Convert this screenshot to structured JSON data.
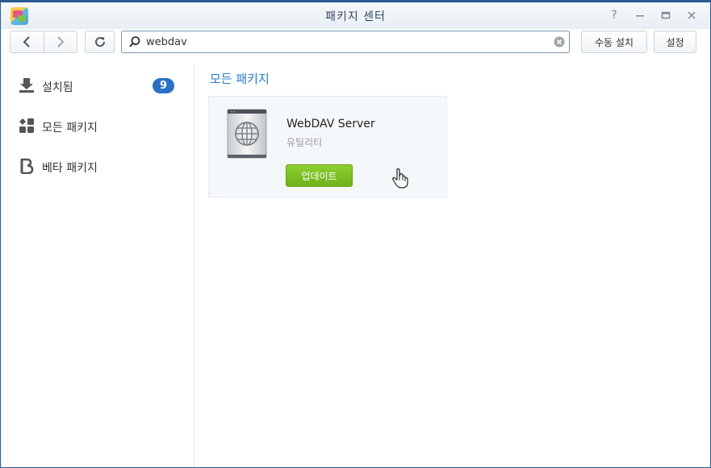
{
  "window": {
    "title": "패키지 센터"
  },
  "toolbar": {
    "search_value": "webdav",
    "manual_install_label": "수동 설치",
    "settings_label": "설정"
  },
  "sidebar": {
    "items": [
      {
        "label": "설치됨",
        "icon": "download-icon",
        "badge": "9"
      },
      {
        "label": "모든 패키지",
        "icon": "grid-icon"
      },
      {
        "label": "베타 패키지",
        "icon": "beta-icon"
      }
    ]
  },
  "main": {
    "section_title": "모든 패키지",
    "package": {
      "name": "WebDAV Server",
      "category": "유틸리티",
      "button_label": "업데이트",
      "icon": "globe-icon"
    }
  },
  "colors": {
    "accent_blue": "#2a7bd0",
    "badge_blue": "#2a71c4",
    "update_green": "#7bbf22",
    "frame_blue": "#2d5b91"
  }
}
